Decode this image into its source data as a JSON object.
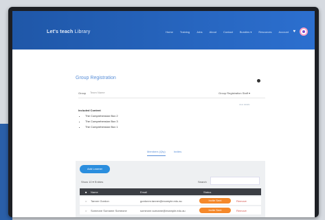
{
  "header": {
    "logo_bold": "Let's teach",
    "logo_light": " Library",
    "nav": [
      "Home",
      "Training",
      "Jobs",
      "About",
      "Contact",
      "Bundles ▾",
      "Resources",
      "Account"
    ],
    "heart_icon": "heart-icon",
    "avatar_icon": "user-avatar"
  },
  "page": {
    "title": "Group Registration",
    "group_label": "Group",
    "group_placeholder": "Team Name",
    "select_label": "Group Registration Staff ▾",
    "side_link": "view details"
  },
  "included": {
    "title": "Included Content",
    "items": [
      "The Comprehension Box 2",
      "The Comprehension Box 3",
      "The Comprehension Box 1"
    ]
  },
  "tabs": [
    "Members (Qty)",
    "Invites"
  ],
  "panel": {
    "add_button": "Add Learner",
    "show_label": "Show  10  ▾ Entries",
    "search_label": "Search",
    "columns": [
      "Name",
      "Email",
      "Status"
    ],
    "rows": [
      {
        "name": "Tanner Gordon",
        "email": "gordonm.tanner@example.edu.au",
        "status": "Invite Sent",
        "action": "Remove"
      },
      {
        "name": "Someone Surname Someone",
        "email": "someone.surname@example.edu.au",
        "status": "Invite Sent",
        "action": "Remove"
      }
    ]
  },
  "colors": {
    "header": "#2c6fcf",
    "accent": "#5a8fd8",
    "button": "#2b8ede",
    "badge": "#f5892b"
  }
}
